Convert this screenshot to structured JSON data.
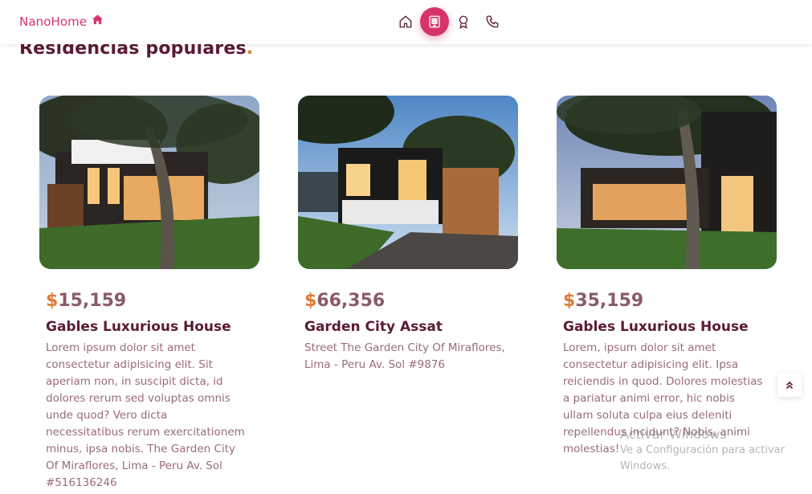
{
  "header": {
    "logo_text": "NanoHome",
    "logo_icon": "home-solid-icon",
    "nav": [
      {
        "icon": "home-icon",
        "active": false
      },
      {
        "icon": "building-icon",
        "active": true
      },
      {
        "icon": "award-icon",
        "active": false
      },
      {
        "icon": "phone-icon",
        "active": false
      }
    ]
  },
  "section": {
    "title": "Residencias populares",
    "dot": "."
  },
  "cards": [
    {
      "currency": "$",
      "amount": "15,159",
      "name": "Gables Luxurious House",
      "description": "Lorem ipsum dolor sit amet consectetur adipisicing elit. Sit aperiam non, in suscipit dicta, id dolores rerum sed voluptas omnis unde quod? Vero dicta necessitatibus rerum exercitationem minus, ipsa nobis. The Garden City Of Miraflores, Lima - Peru Av. Sol #516136246"
    },
    {
      "currency": "$",
      "amount": "66,356",
      "name": "Garden City Assat",
      "description": "Street The Garden City Of Miraflores, Lima - Peru Av. Sol #9876"
    },
    {
      "currency": "$",
      "amount": "35,159",
      "name": "Gables Luxurious House",
      "description": "Lorem, ipsum dolor sit amet consectetur adipisicing elit. Ipsa reiciendis in quod. Dolores molestias a pariatur animi error, hic nobis ullam soluta culpa eius deleniti repellendus incidunt? Nobis, animi molestias!"
    }
  ],
  "scroll_top_icon": "double-chevron-up-icon",
  "watermark": {
    "line1": "Activar Windows",
    "line2": "Ve a Configuración para activar Windows."
  },
  "colors": {
    "accent": "#d6336c",
    "price": "#e07a36",
    "title": "#5b1a36"
  }
}
